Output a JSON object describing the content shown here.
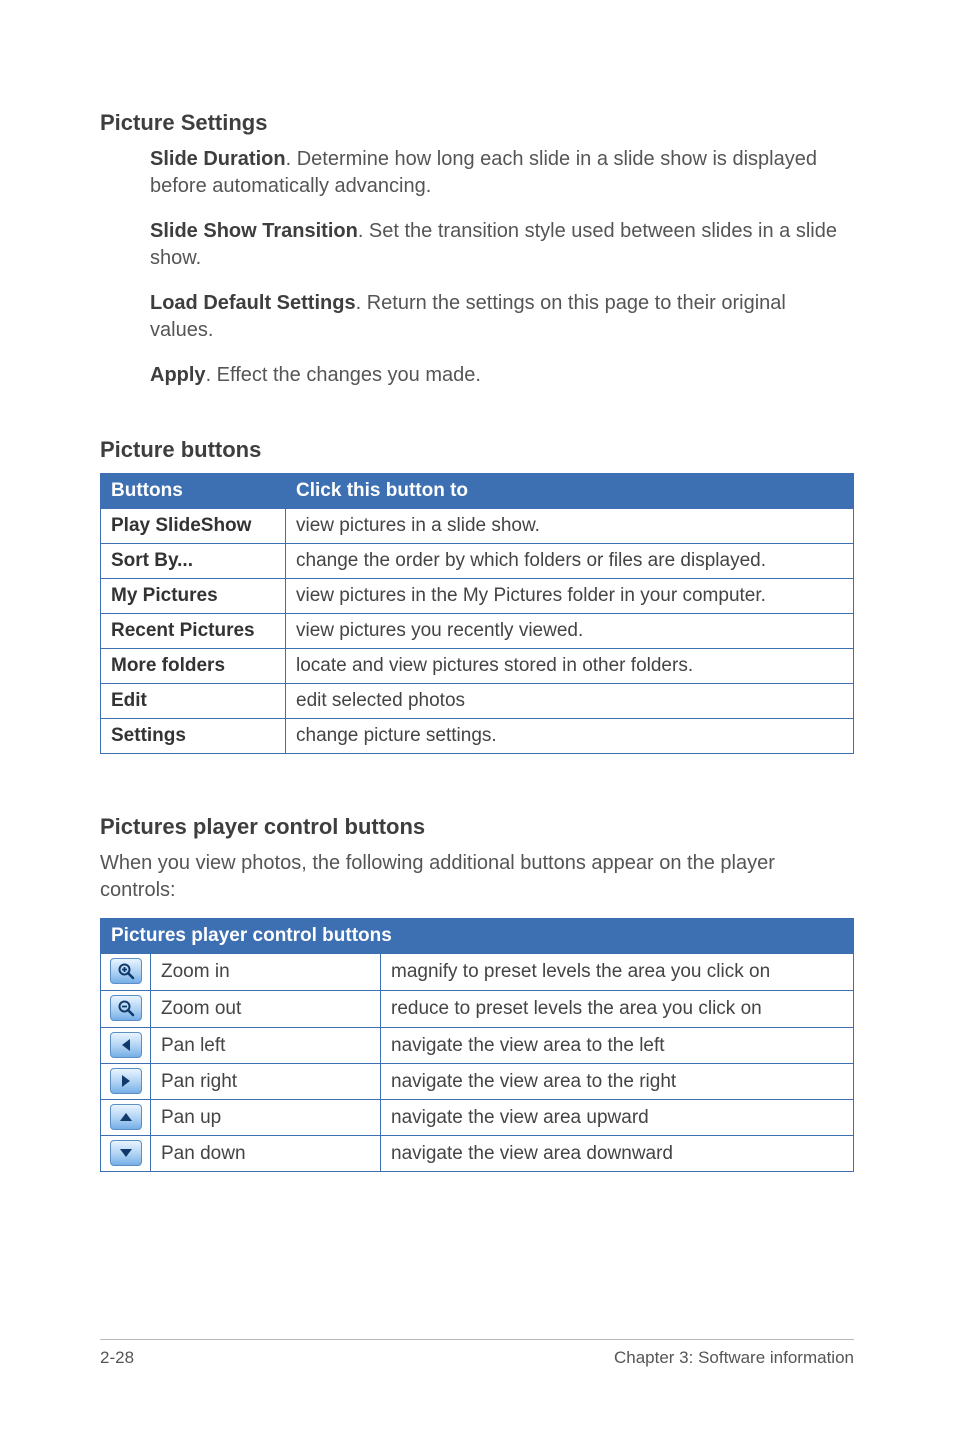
{
  "picture_settings": {
    "title": "Picture Settings",
    "items": [
      {
        "label": "Slide Duration",
        "text": ". Determine how long each slide in a slide show is displayed before automatically advancing."
      },
      {
        "label": "Slide Show Transition",
        "text": ". Set the transition style used between slides in a slide show."
      },
      {
        "label": "Load Default Settings",
        "text": ". Return the settings on this page to their original values."
      },
      {
        "label": "Apply",
        "text": ". Effect the changes you made."
      }
    ]
  },
  "picture_buttons": {
    "title": "Picture buttons",
    "headers": [
      "Buttons",
      "Click this button to"
    ],
    "rows": [
      {
        "label": "Play SlideShow",
        "desc": "view pictures in a slide show."
      },
      {
        "label": "Sort By...",
        "desc": "change the order by which folders or files are displayed."
      },
      {
        "label": "My Pictures",
        "desc": "view pictures in the My Pictures folder in your computer."
      },
      {
        "label": "Recent Pictures",
        "desc": "view pictures you recently viewed."
      },
      {
        "label": "More folders",
        "desc": "locate and view pictures stored in other folders."
      },
      {
        "label": "Edit",
        "desc": "edit selected photos"
      },
      {
        "label": "Settings",
        "desc": "change picture settings."
      }
    ]
  },
  "player_controls": {
    "title": "Pictures player control buttons",
    "intro": "When you view photos, the following additional buttons appear on the player controls:",
    "header": "Pictures player control buttons",
    "rows": [
      {
        "icon": "zoom-in",
        "name": "Zoom in",
        "desc": "magnify to preset levels the area you click on"
      },
      {
        "icon": "zoom-out",
        "name": "Zoom out",
        "desc": "reduce to preset levels the area you click on"
      },
      {
        "icon": "pan-left",
        "name": "Pan left",
        "desc": "navigate the view area to the left"
      },
      {
        "icon": "pan-right",
        "name": "Pan right",
        "desc": "navigate the view area to the right"
      },
      {
        "icon": "pan-up",
        "name": "Pan up",
        "desc": "navigate the view area upward"
      },
      {
        "icon": "pan-down",
        "name": "Pan down",
        "desc": "navigate the view area downward"
      }
    ]
  },
  "footer": {
    "left": "2-28",
    "right": "Chapter 3: Software information"
  }
}
